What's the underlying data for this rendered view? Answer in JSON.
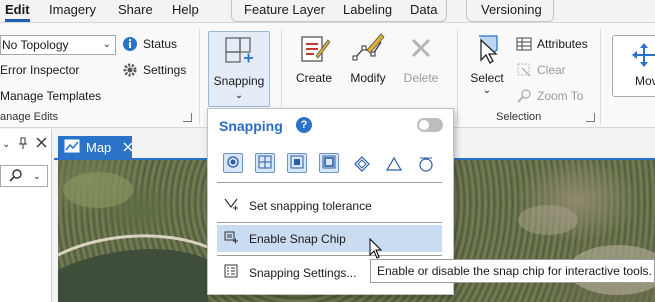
{
  "tabs": {
    "edit": "Edit",
    "imagery": "Imagery",
    "share": "Share",
    "help": "Help",
    "feature_layer": "Feature Layer",
    "labeling": "Labeling",
    "data": "Data",
    "versioning": "Versioning"
  },
  "ribbon": {
    "topology_select": "No Topology",
    "status": "Status",
    "error_inspector": "Error Inspector",
    "settings": "Settings",
    "manage_templates": "Manage Templates",
    "manage_edits_group": "anage Edits",
    "snapping": "Snapping",
    "create": "Create",
    "modify": "Modify",
    "delete": "Delete",
    "select": "Select",
    "attributes": "Attributes",
    "clear": "Clear",
    "zoom_to": "Zoom To",
    "selection_group": "Selection",
    "move": "Mov"
  },
  "map_tab": {
    "label": "Map"
  },
  "snapping_menu": {
    "title": "Snapping",
    "help_icon": "?",
    "snap_tolerance": "Set snapping tolerance",
    "enable_snap_chip": "Enable Snap Chip",
    "snapping_settings": "Snapping Settings..."
  },
  "tooltip": {
    "text": "Enable or disable the snap chip for interactive tools."
  },
  "colors": {
    "accent": "#2a73c9",
    "hover_row": "#c9dcf1",
    "active_tab_underline": "#1e5fb3"
  }
}
